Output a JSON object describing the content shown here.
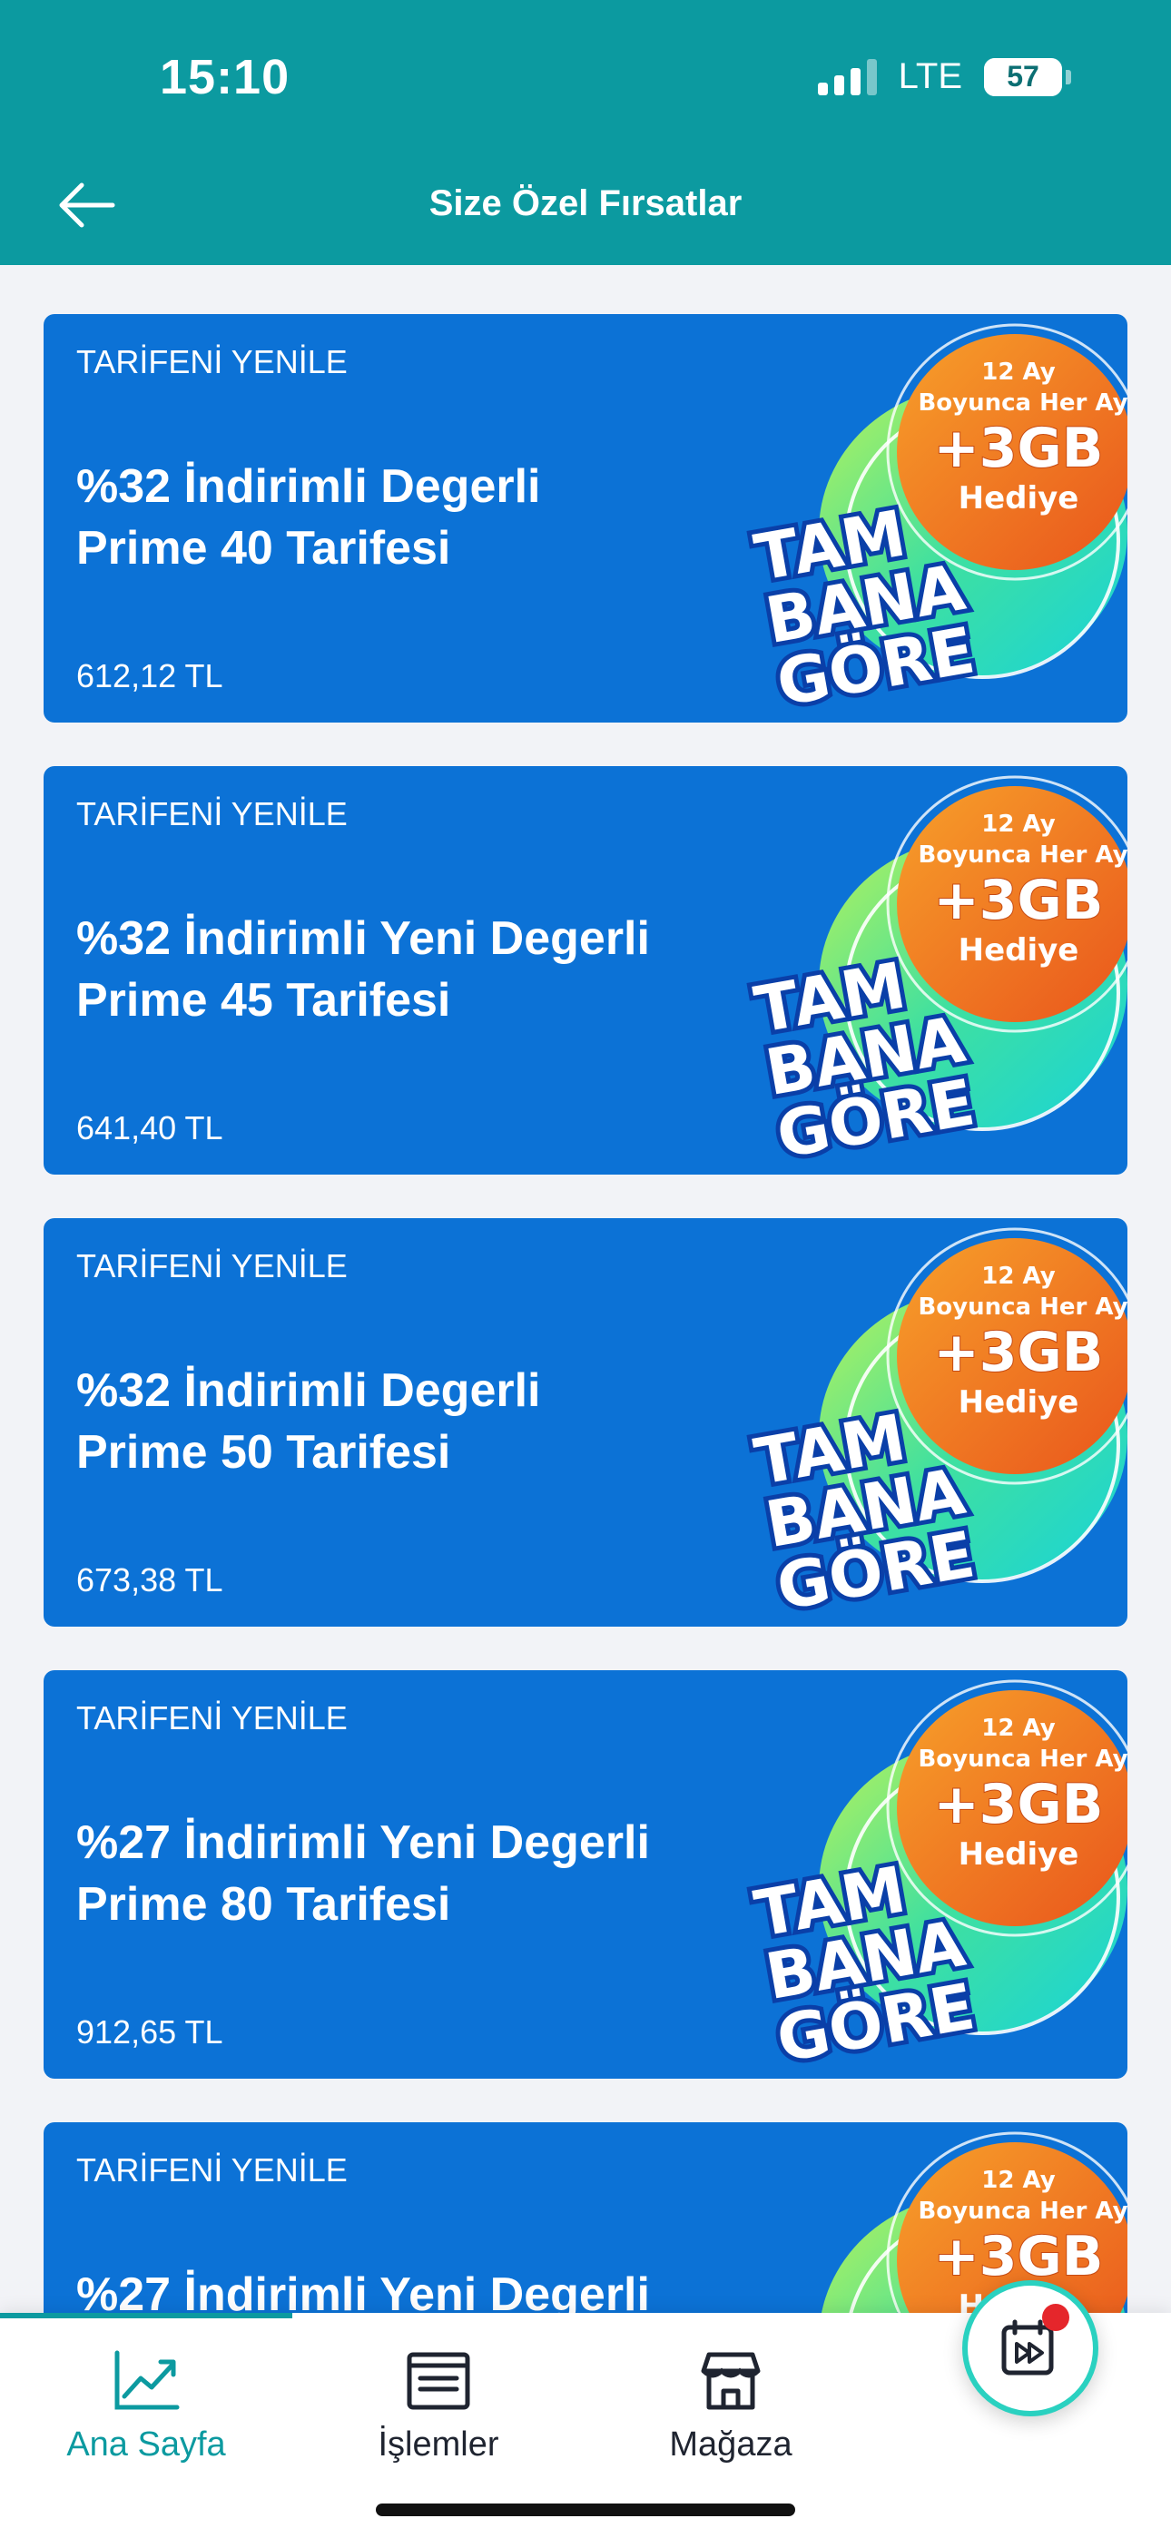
{
  "status_bar": {
    "time": "15:10",
    "network": "LTE",
    "battery": "57"
  },
  "header": {
    "title": "Size Özel Fırsatlar"
  },
  "cards": [
    {
      "tag": "TARİFENİ YENİLE",
      "title_line1": "%32 İndirimli Degerli",
      "title_line2": "Prime 40 Tarifesi",
      "price": "612,12 TL"
    },
    {
      "tag": "TARİFENİ YENİLE",
      "title_line1": "%32 İndirimli Yeni Degerli",
      "title_line2": "Prime 45 Tarifesi",
      "price": "641,40 TL"
    },
    {
      "tag": "TARİFENİ YENİLE",
      "title_line1": "%32 İndirimli Degerli",
      "title_line2": "Prime 50 Tarifesi",
      "price": "673,38 TL"
    },
    {
      "tag": "TARİFENİ YENİLE",
      "title_line1": "%27 İndirimli Yeni Degerli",
      "title_line2": "Prime 80 Tarifesi",
      "price": "912,65 TL"
    },
    {
      "tag": "TARİFENİ YENİLE",
      "title_line1": "%27 İndirimli Yeni Degerli",
      "title_line2": "",
      "price": ""
    }
  ],
  "badge": {
    "line1": "12 Ay",
    "line2": "Boyunca Her Ay",
    "line3": "+3GB",
    "line4": "Hediye",
    "brand1": "TAM",
    "brand2": "BANA",
    "brand3": "GÖRE"
  },
  "bottom_nav": [
    {
      "label": "Ana Sayfa",
      "icon": "chart-trend-icon",
      "active": true
    },
    {
      "label": "İşlemler",
      "icon": "list-window-icon",
      "active": false
    },
    {
      "label": "Mağaza",
      "icon": "store-icon",
      "active": false
    }
  ],
  "colors": {
    "header": "#0c9aa0",
    "card": "#0c72d6",
    "accent": "#0c9aa0",
    "badge_orange": "#f07a1e"
  }
}
